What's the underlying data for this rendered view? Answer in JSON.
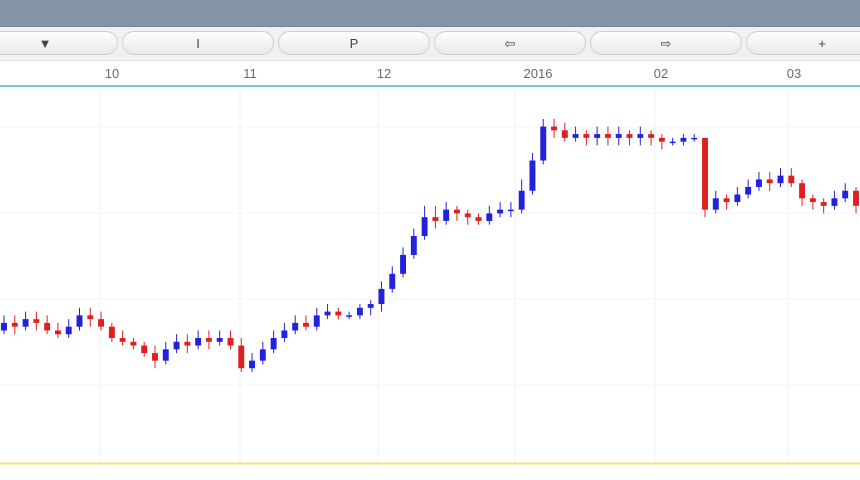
{
  "toolbar": {
    "buttons": [
      {
        "name": "dropdown-button",
        "icon": "triangle-down-icon",
        "label": "▼"
      },
      {
        "name": "cursor-button",
        "icon": "cursor-icon",
        "label": "I"
      },
      {
        "name": "p-button",
        "icon": "p-icon",
        "label": "P"
      },
      {
        "name": "scroll-left-button",
        "icon": "double-arrow-left-icon",
        "label": "⇦"
      },
      {
        "name": "scroll-right-button",
        "icon": "double-arrow-right-icon",
        "label": "⇨"
      },
      {
        "name": "zoom-in-button",
        "icon": "plus-icon",
        "label": "+"
      }
    ]
  },
  "time_axis": {
    "labels": [
      "10",
      "11",
      "12",
      "2016",
      "02",
      "03"
    ]
  },
  "colors": {
    "up": "#2222dd",
    "down": "#e02020",
    "axis_line": "#7cc5e6",
    "baseline": "#f6e07a",
    "title_bar": "#8593a9"
  },
  "chart_data": {
    "type": "candlestick",
    "x_labels": [
      "10",
      "11",
      "12",
      "2016",
      "02",
      "03"
    ],
    "y_scale": "unlabeled",
    "series": [
      {
        "values": [
          {
            "o": 320,
            "c": 322,
            "h": 324,
            "l": 319
          },
          {
            "o": 322,
            "c": 321,
            "h": 324,
            "l": 319
          },
          {
            "o": 321,
            "c": 323,
            "h": 325,
            "l": 320
          },
          {
            "o": 323,
            "c": 322,
            "h": 325,
            "l": 320
          },
          {
            "o": 322,
            "c": 320,
            "h": 324,
            "l": 319
          },
          {
            "o": 320,
            "c": 319,
            "h": 322,
            "l": 318
          },
          {
            "o": 319,
            "c": 321,
            "h": 323,
            "l": 318
          },
          {
            "o": 321,
            "c": 324,
            "h": 326,
            "l": 320
          },
          {
            "o": 324,
            "c": 323,
            "h": 326,
            "l": 321
          },
          {
            "o": 323,
            "c": 321,
            "h": 325,
            "l": 320
          },
          {
            "o": 321,
            "c": 318,
            "h": 322,
            "l": 317
          },
          {
            "o": 318,
            "c": 317,
            "h": 320,
            "l": 316
          },
          {
            "o": 317,
            "c": 316,
            "h": 318,
            "l": 315
          },
          {
            "o": 316,
            "c": 314,
            "h": 317,
            "l": 313
          },
          {
            "o": 314,
            "c": 312,
            "h": 316,
            "l": 310
          },
          {
            "o": 312,
            "c": 315,
            "h": 317,
            "l": 311
          },
          {
            "o": 315,
            "c": 317,
            "h": 319,
            "l": 314
          },
          {
            "o": 317,
            "c": 316,
            "h": 319,
            "l": 314
          },
          {
            "o": 316,
            "c": 318,
            "h": 320,
            "l": 315
          },
          {
            "o": 318,
            "c": 317,
            "h": 320,
            "l": 315
          },
          {
            "o": 317,
            "c": 318,
            "h": 320,
            "l": 316
          },
          {
            "o": 318,
            "c": 316,
            "h": 320,
            "l": 315
          },
          {
            "o": 316,
            "c": 310,
            "h": 318,
            "l": 309
          },
          {
            "o": 310,
            "c": 312,
            "h": 314,
            "l": 309
          },
          {
            "o": 312,
            "c": 315,
            "h": 317,
            "l": 311
          },
          {
            "o": 315,
            "c": 318,
            "h": 320,
            "l": 314
          },
          {
            "o": 318,
            "c": 320,
            "h": 322,
            "l": 317
          },
          {
            "o": 320,
            "c": 322,
            "h": 324,
            "l": 319
          },
          {
            "o": 322,
            "c": 321,
            "h": 324,
            "l": 320
          },
          {
            "o": 321,
            "c": 324,
            "h": 326,
            "l": 320
          },
          {
            "o": 324,
            "c": 325,
            "h": 327,
            "l": 323
          },
          {
            "o": 325,
            "c": 324,
            "h": 326,
            "l": 323
          },
          {
            "o": 324,
            "c": 324,
            "h": 325,
            "l": 323
          },
          {
            "o": 324,
            "c": 326,
            "h": 327,
            "l": 323
          },
          {
            "o": 326,
            "c": 327,
            "h": 328,
            "l": 324
          },
          {
            "o": 327,
            "c": 331,
            "h": 333,
            "l": 325
          },
          {
            "o": 331,
            "c": 335,
            "h": 337,
            "l": 330
          },
          {
            "o": 335,
            "c": 340,
            "h": 342,
            "l": 334
          },
          {
            "o": 340,
            "c": 345,
            "h": 347,
            "l": 339
          },
          {
            "o": 345,
            "c": 350,
            "h": 353,
            "l": 344
          },
          {
            "o": 350,
            "c": 349,
            "h": 353,
            "l": 347
          },
          {
            "o": 349,
            "c": 352,
            "h": 354,
            "l": 348
          },
          {
            "o": 352,
            "c": 351,
            "h": 353,
            "l": 349
          },
          {
            "o": 351,
            "c": 350,
            "h": 352,
            "l": 348
          },
          {
            "o": 350,
            "c": 349,
            "h": 351,
            "l": 348
          },
          {
            "o": 349,
            "c": 351,
            "h": 353,
            "l": 348
          },
          {
            "o": 351,
            "c": 352,
            "h": 354,
            "l": 350
          },
          {
            "o": 352,
            "c": 352,
            "h": 354,
            "l": 350
          },
          {
            "o": 352,
            "c": 357,
            "h": 360,
            "l": 351
          },
          {
            "o": 357,
            "c": 365,
            "h": 367,
            "l": 356
          },
          {
            "o": 365,
            "c": 374,
            "h": 376,
            "l": 364
          },
          {
            "o": 374,
            "c": 373,
            "h": 376,
            "l": 371
          },
          {
            "o": 373,
            "c": 371,
            "h": 375,
            "l": 370
          },
          {
            "o": 371,
            "c": 372,
            "h": 374,
            "l": 370
          },
          {
            "o": 372,
            "c": 371,
            "h": 373,
            "l": 369
          },
          {
            "o": 371,
            "c": 372,
            "h": 374,
            "l": 369
          },
          {
            "o": 372,
            "c": 371,
            "h": 374,
            "l": 369
          },
          {
            "o": 371,
            "c": 372,
            "h": 374,
            "l": 369
          },
          {
            "o": 372,
            "c": 371,
            "h": 373,
            "l": 369
          },
          {
            "o": 371,
            "c": 372,
            "h": 374,
            "l": 369
          },
          {
            "o": 372,
            "c": 371,
            "h": 373,
            "l": 369
          },
          {
            "o": 371,
            "c": 370,
            "h": 372,
            "l": 368
          },
          {
            "o": 370,
            "c": 370,
            "h": 371,
            "l": 369
          },
          {
            "o": 370,
            "c": 371,
            "h": 372,
            "l": 369
          },
          {
            "o": 371,
            "c": 371,
            "h": 372,
            "l": 370
          },
          {
            "o": 371,
            "c": 352,
            "h": 371,
            "l": 350
          },
          {
            "o": 352,
            "c": 355,
            "h": 357,
            "l": 351
          },
          {
            "o": 355,
            "c": 354,
            "h": 356,
            "l": 352
          },
          {
            "o": 354,
            "c": 356,
            "h": 358,
            "l": 353
          },
          {
            "o": 356,
            "c": 358,
            "h": 360,
            "l": 355
          },
          {
            "o": 358,
            "c": 360,
            "h": 362,
            "l": 357
          },
          {
            "o": 360,
            "c": 359,
            "h": 362,
            "l": 357
          },
          {
            "o": 359,
            "c": 361,
            "h": 363,
            "l": 358
          },
          {
            "o": 361,
            "c": 359,
            "h": 363,
            "l": 358
          },
          {
            "o": 359,
            "c": 355,
            "h": 360,
            "l": 353
          },
          {
            "o": 355,
            "c": 354,
            "h": 356,
            "l": 352
          },
          {
            "o": 354,
            "c": 353,
            "h": 355,
            "l": 351
          },
          {
            "o": 353,
            "c": 355,
            "h": 357,
            "l": 352
          },
          {
            "o": 355,
            "c": 357,
            "h": 359,
            "l": 354
          },
          {
            "o": 357,
            "c": 353,
            "h": 358,
            "l": 351
          }
        ]
      }
    ]
  }
}
